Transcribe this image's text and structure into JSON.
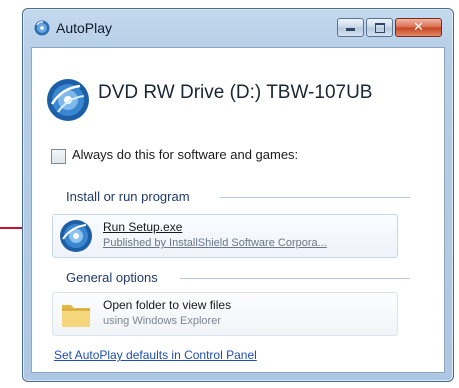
{
  "window": {
    "title": "AutoPlay",
    "controls": {
      "minimize": "minimize",
      "maximize": "maximize",
      "close": "✕"
    }
  },
  "drive": {
    "title": "DVD RW Drive (D:) TBW-107UB",
    "icon": "cd-drive-icon"
  },
  "always_checkbox": {
    "label": "Always do this for software and games:",
    "checked": false
  },
  "install_section": {
    "title": "Install or run program",
    "options": [
      {
        "main": "Run Setup.exe",
        "sub": "Published by InstallShield Software Corpora...",
        "icon": "setup-disc-icon"
      }
    ]
  },
  "general_section": {
    "title": "General options",
    "options": [
      {
        "main": "Open folder to view files",
        "sub": "using Windows Explorer",
        "icon": "folder-icon"
      }
    ]
  },
  "footer_link": "Set AutoPlay defaults in Control Panel",
  "colors": {
    "annotation": "#c8102e",
    "link": "#1f4fb0",
    "section_title": "#1f3a69"
  }
}
